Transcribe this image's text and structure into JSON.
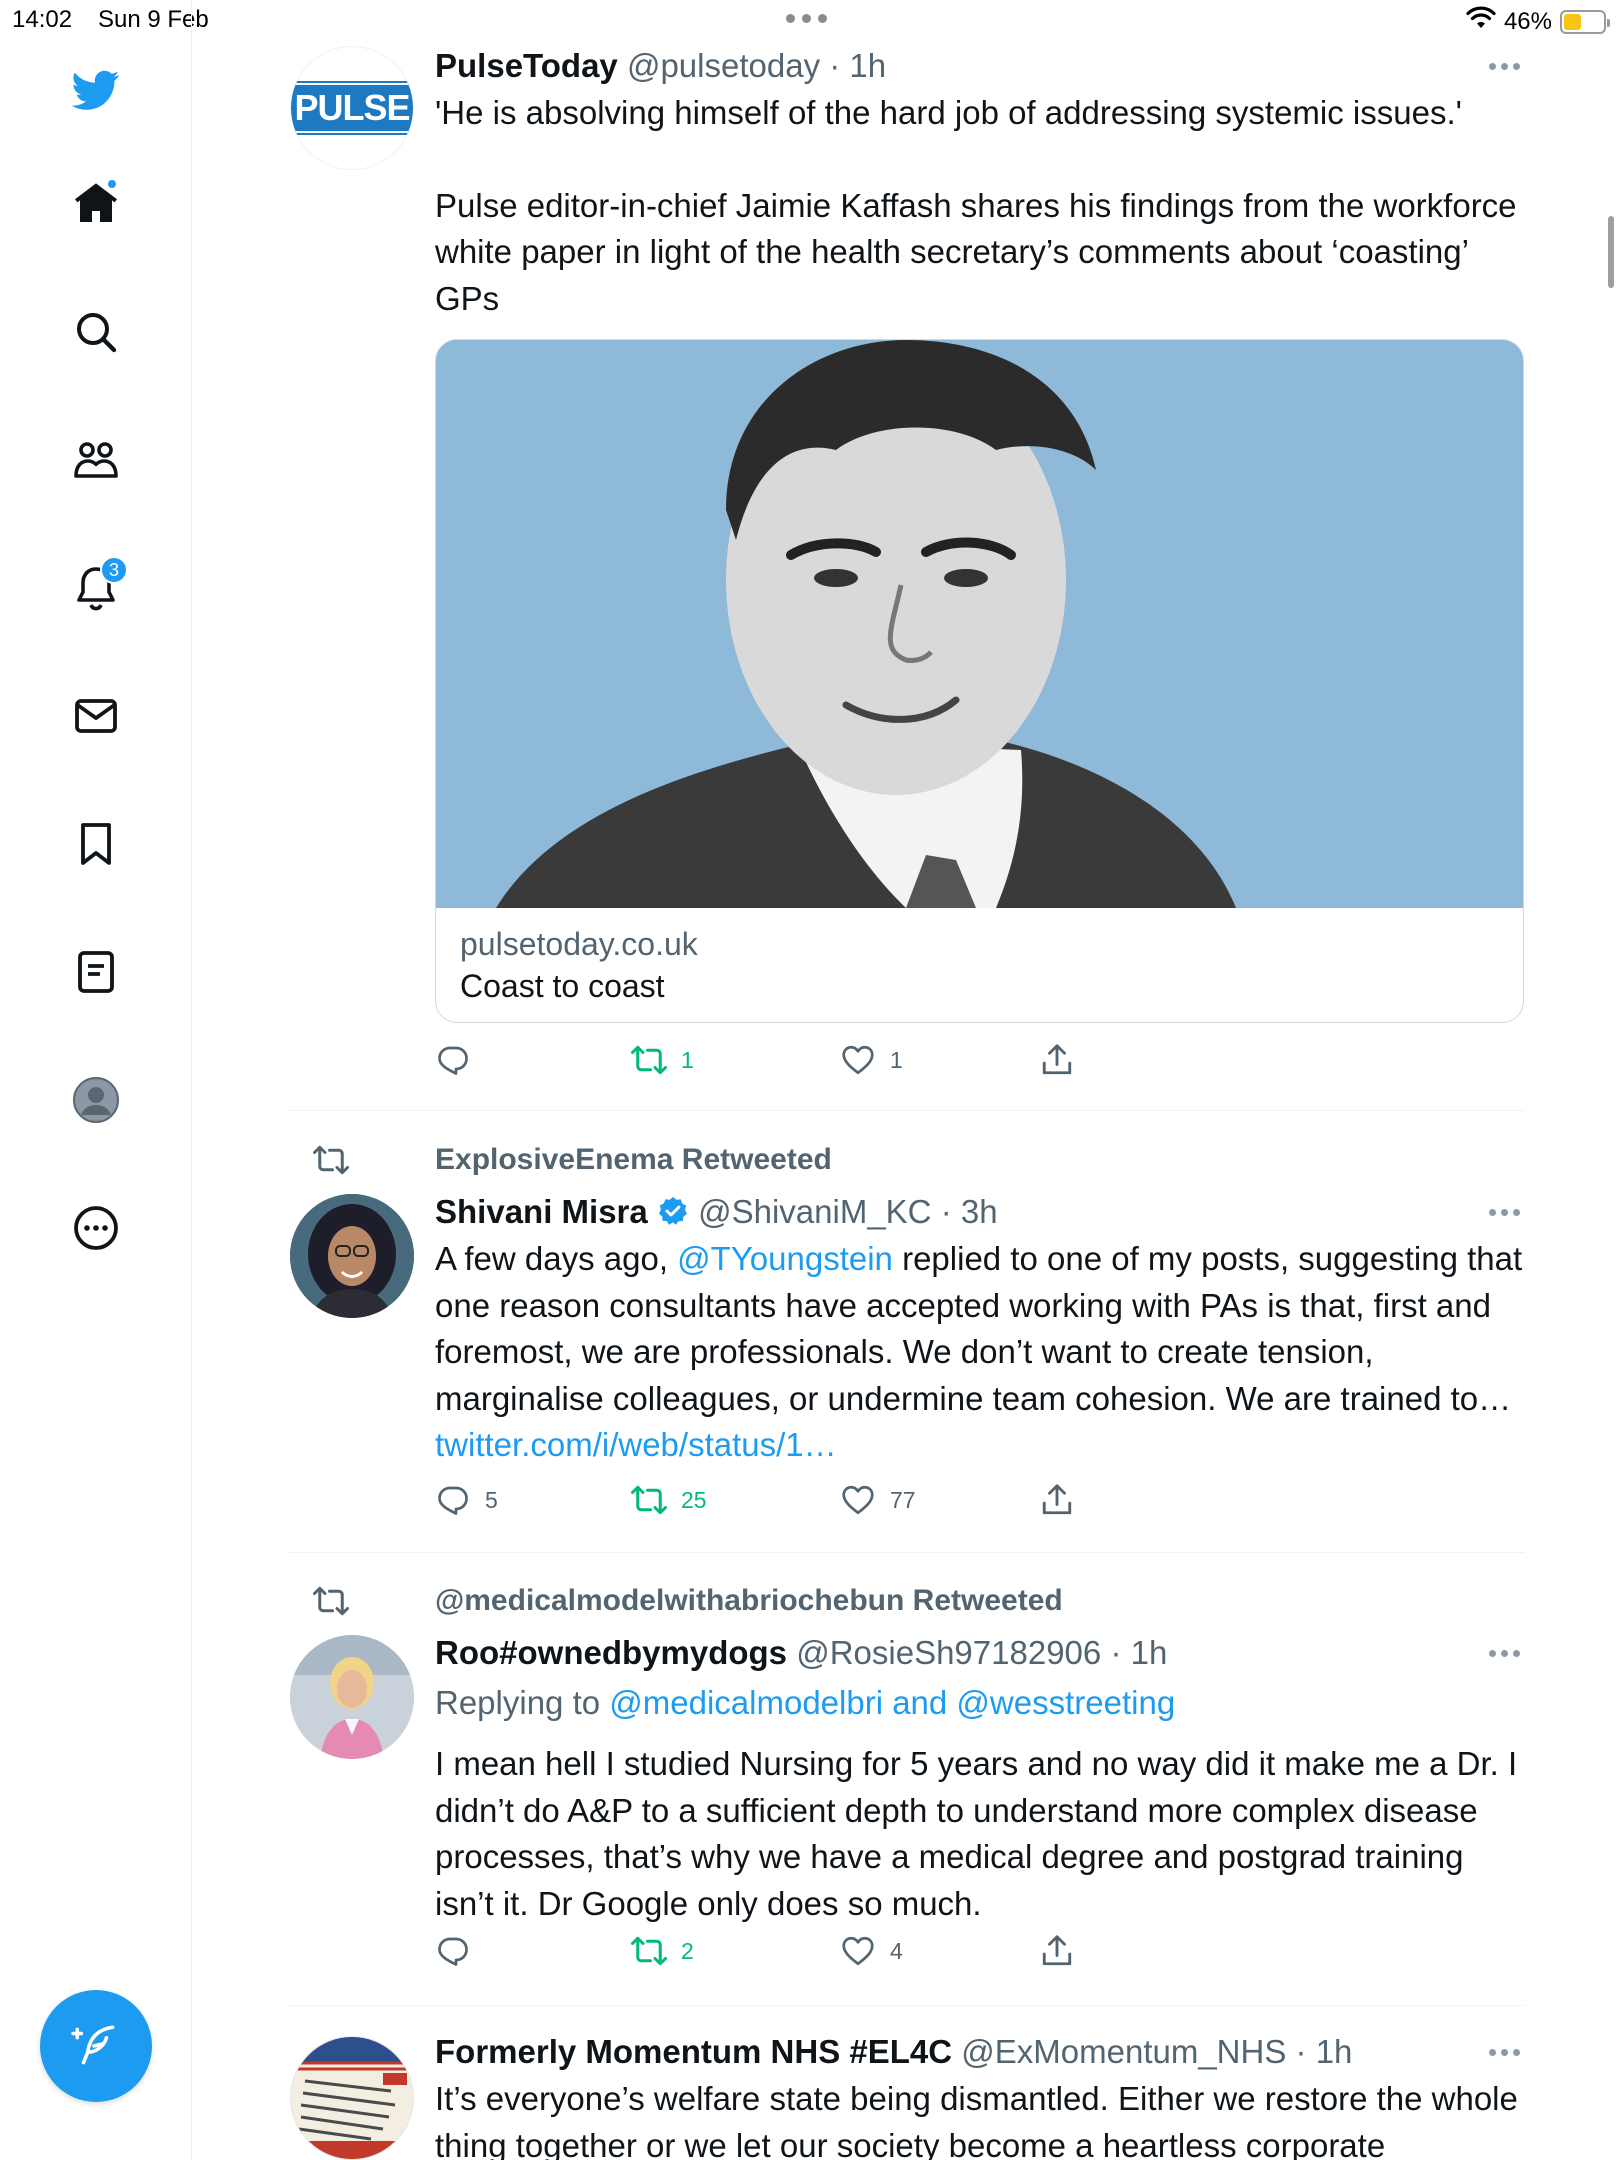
{
  "status_bar": {
    "time": "14:02",
    "date": "Sun 9 Feb",
    "battery": "46%"
  },
  "sidebar": {
    "notifications_badge": "3",
    "colors": {
      "brand": "#1d9bf0",
      "icon": "#0f1419"
    }
  },
  "tweets": [
    {
      "name": "PulseToday",
      "handle": "@pulsetoday",
      "time": "· 1h",
      "avatar_text": "PULSE",
      "text_1": "'He is absolving himself of the hard job of addressing systemic issues.'",
      "text_2": "Pulse editor-in-chief Jaimie Kaffash shares his findings from the workforce white paper in light of the health secretary’s comments about ‘coasting’ GPs",
      "card": {
        "domain": "pulsetoday.co.uk",
        "title": "Coast to coast"
      },
      "replies": "",
      "retweets": "1",
      "likes": "1"
    },
    {
      "retweeted_by": "ExplosiveEnema Retweeted",
      "name": "Shivani Misra",
      "handle": "@ShivaniM_KC",
      "time": "· 3h",
      "text_prefix": "A few days ago, ",
      "mention": "@TYoungstein",
      "text_middle": " replied to one of my posts, suggesting that one reason consultants have accepted working with PAs is that, first and foremost, we are professionals. We don’t want to create tension, marginalise colleagues, or undermine team cohesion. We are trained to… ",
      "link": "twitter.com/i/web/status/1…",
      "replies": "5",
      "retweets": "25",
      "likes": "77"
    },
    {
      "retweeted_by": "@medicalmodelwithabriochebun Retweeted",
      "name": "Roo#ownedbymydogs",
      "handle": "@RosieSh97182906",
      "time": "· 1h",
      "replying_label": "Replying to ",
      "replying_to": "@medicalmodelbri and @wesstreeting",
      "text": "I mean hell I studied Nursing for 5 years and no way did it make me a Dr. I didn’t do A&P to a sufficient depth to understand more complex disease processes, that’s why we have a medical degree and postgrad training isn’t it. Dr Google only does so much.",
      "replies": "",
      "retweets": "2",
      "likes": "4"
    },
    {
      "name": "Formerly Momentum NHS #EL4C",
      "handle": "@ExMomentum_NHS",
      "time": "· 1h",
      "text": "It’s everyone’s welfare state being dismantled. Either we restore the whole thing together or we let our society become a heartless corporate"
    }
  ]
}
